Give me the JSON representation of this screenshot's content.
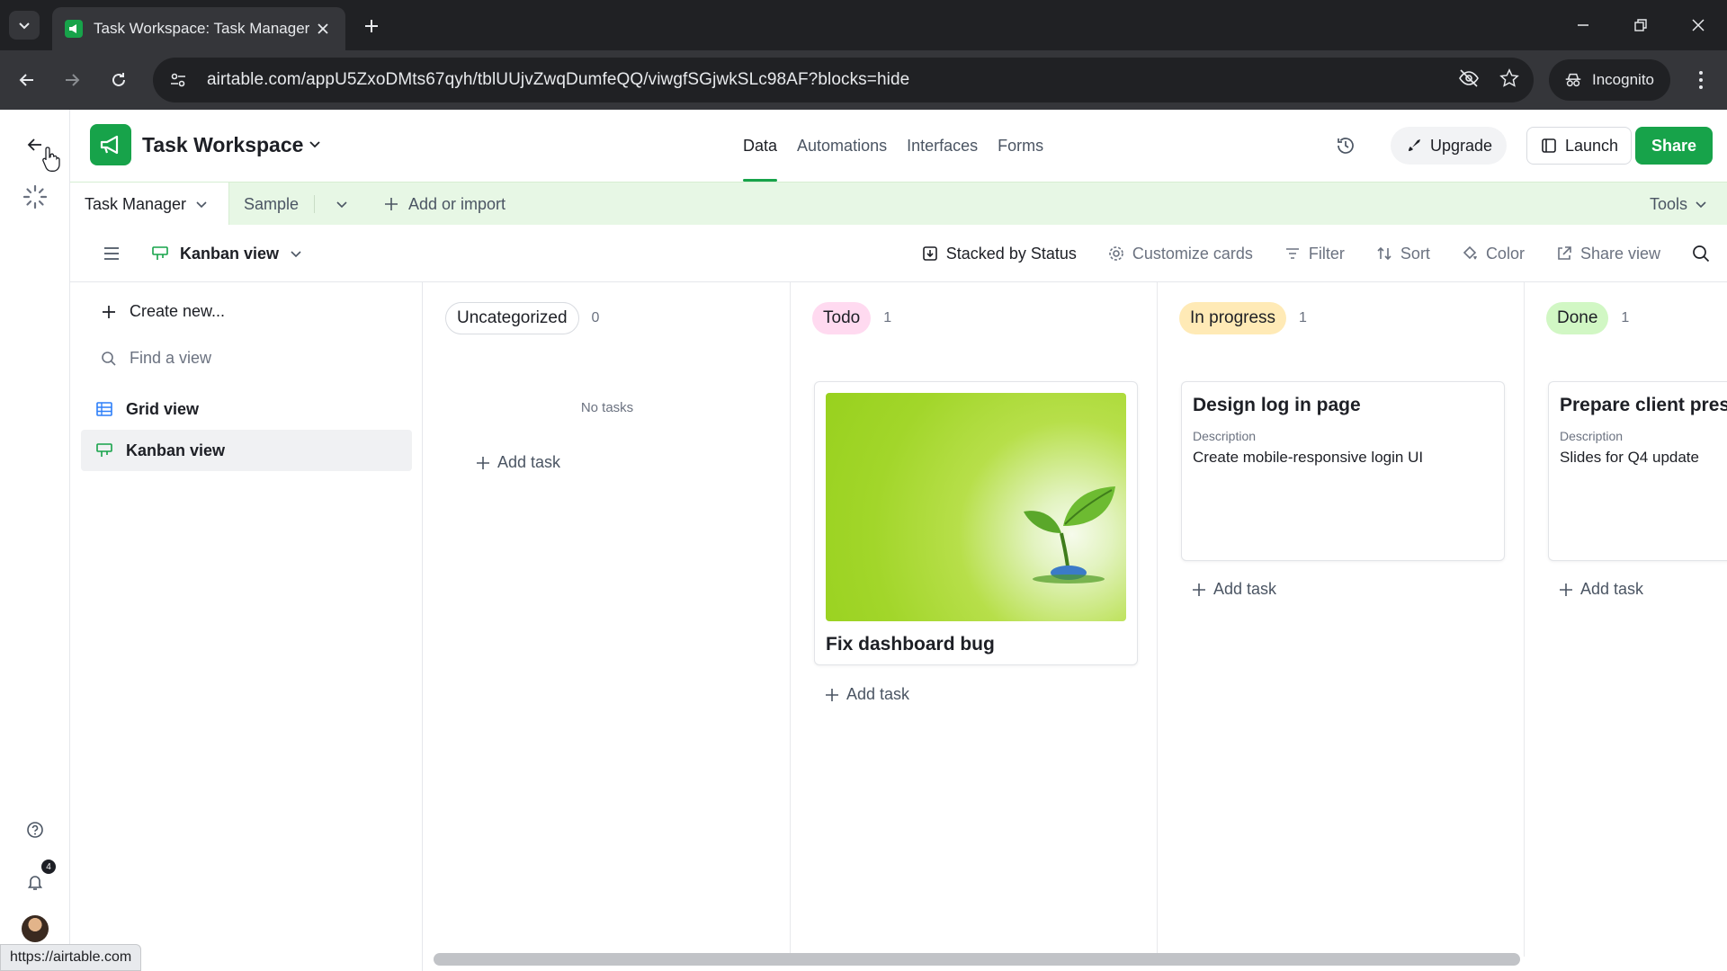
{
  "browser": {
    "tab_title": "Task Workspace: Task Manager",
    "url": "airtable.com/appU5ZxoDMts67qyh/tblUUjvZwqDumfeQQ/viwgfSGjwkSLc98AF?blocks=hide",
    "incognito_label": "Incognito",
    "status_url": "https://airtable.com"
  },
  "rail": {
    "notification_count": "4"
  },
  "header": {
    "base_name": "Task Workspace",
    "tabs": [
      {
        "label": "Data"
      },
      {
        "label": "Automations"
      },
      {
        "label": "Interfaces"
      },
      {
        "label": "Forms"
      }
    ],
    "upgrade_label": "Upgrade",
    "launch_label": "Launch",
    "share_label": "Share"
  },
  "tables": {
    "active": "Task Manager",
    "other": "Sample",
    "add_label": "Add or import",
    "tools_label": "Tools"
  },
  "viewbar": {
    "current_view": "Kanban view",
    "stacked_label": "Stacked by Status",
    "customize_label": "Customize cards",
    "filter_label": "Filter",
    "sort_label": "Sort",
    "color_label": "Color",
    "share_view_label": "Share view"
  },
  "views_sidebar": {
    "create_label": "Create new...",
    "find_placeholder": "Find a view",
    "items": [
      {
        "label": "Grid view"
      },
      {
        "label": "Kanban view"
      }
    ]
  },
  "board": {
    "add_task_label": "Add task",
    "columns": [
      {
        "name": "Uncategorized",
        "count": "0",
        "empty_text": "No tasks",
        "color": "#ffffff"
      },
      {
        "name": "Todo",
        "count": "1",
        "color": "#ffdaf0"
      },
      {
        "name": "In progress",
        "count": "1",
        "color": "#ffeab6"
      },
      {
        "name": "Done",
        "count": "1",
        "color": "#d1f7c4"
      }
    ],
    "cards": {
      "todo": {
        "title": "Fix dashboard bug"
      },
      "in_progress": {
        "title": "Design log in page",
        "field_label": "Description",
        "description": "Create mobile-responsive login UI"
      },
      "done": {
        "title": "Prepare client pres",
        "field_label": "Description",
        "description": "Slides for Q4 update"
      }
    }
  },
  "colors": {
    "brand_green": "#17a34a",
    "table_bar_bg": "#e7f7e5"
  }
}
